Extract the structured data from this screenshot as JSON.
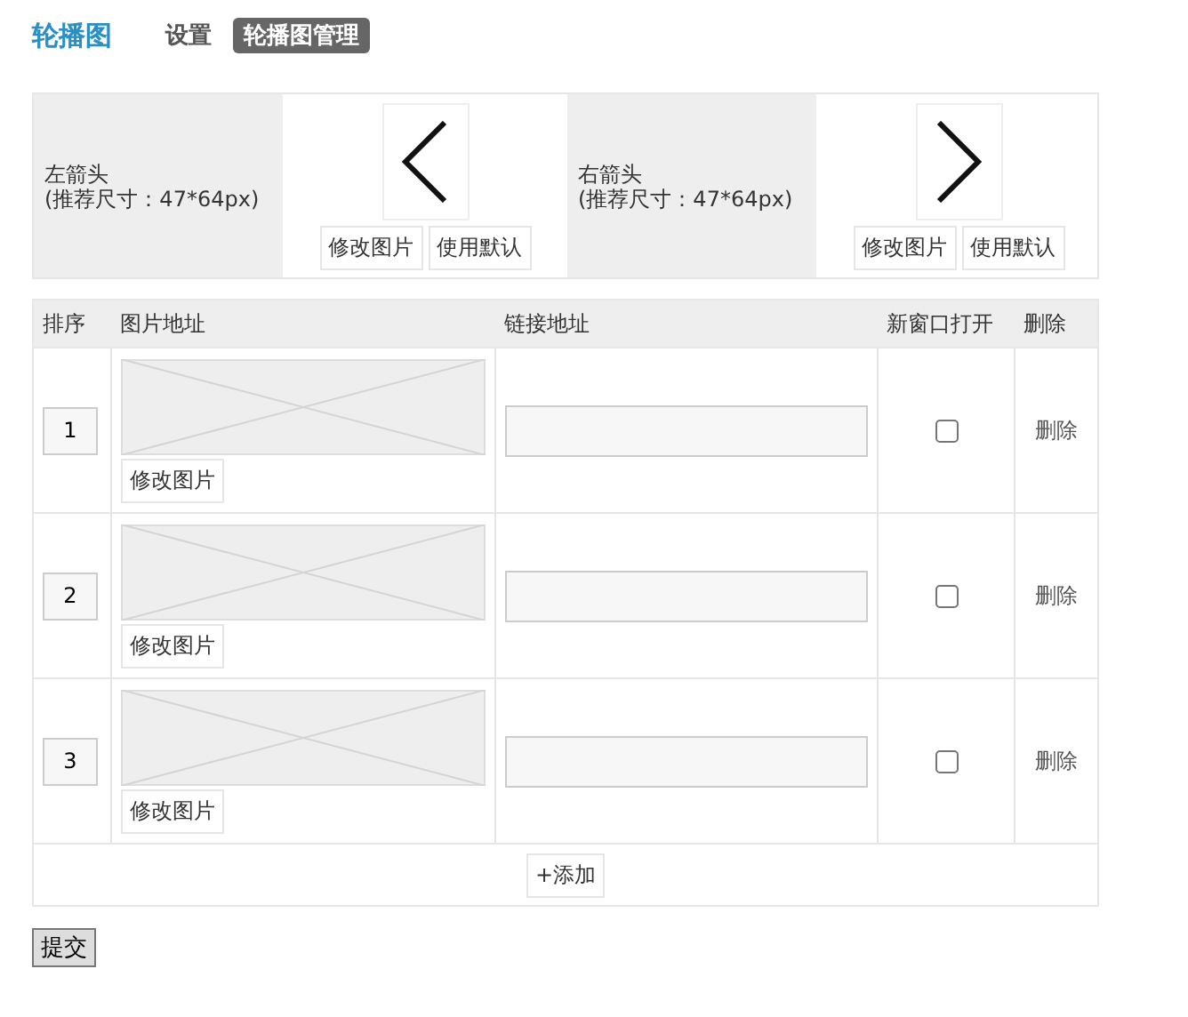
{
  "title": "轮播图",
  "tabs": [
    {
      "label": "设置",
      "selected": false
    },
    {
      "label": "轮播图管理",
      "selected": true
    }
  ],
  "arrows": [
    {
      "kind": "left",
      "label": "左箭头",
      "hint": "(推荐尺寸：47*64px)",
      "buttons": [
        "修改图片",
        "使用默认"
      ]
    },
    {
      "kind": "right",
      "label": "右箭头",
      "hint": "(推荐尺寸：47*64px)",
      "buttons": [
        "修改图片",
        "使用默认"
      ]
    }
  ],
  "table": {
    "columns": [
      "排序",
      "图片地址",
      "链接地址",
      "新窗口打开",
      "删除"
    ],
    "rows": [
      {
        "order": "1",
        "image_button": "修改图片",
        "new_window": false,
        "delete": "删除"
      },
      {
        "order": "2",
        "image_button": "修改图片",
        "new_window": false,
        "delete": "删除"
      },
      {
        "order": "3",
        "image_button": "修改图片",
        "new_window": false,
        "delete": "删除"
      }
    ],
    "add_button": "+添加"
  },
  "submit": "提交"
}
